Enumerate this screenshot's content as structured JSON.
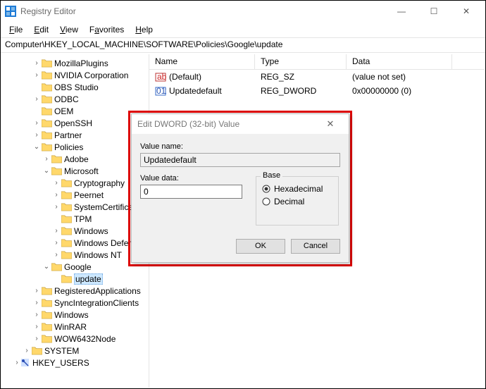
{
  "window": {
    "title": "Registry Editor"
  },
  "menu": {
    "file": "File",
    "edit": "Edit",
    "view": "View",
    "favorites": "Favorites",
    "help": "Help"
  },
  "address": "Computer\\HKEY_LOCAL_MACHINE\\SOFTWARE\\Policies\\Google\\update",
  "tree": {
    "items": [
      {
        "indent": 3,
        "twisty": ">",
        "label": "MozillaPlugins"
      },
      {
        "indent": 3,
        "twisty": ">",
        "label": "NVIDIA Corporation"
      },
      {
        "indent": 3,
        "twisty": "",
        "label": "OBS Studio"
      },
      {
        "indent": 3,
        "twisty": ">",
        "label": "ODBC"
      },
      {
        "indent": 3,
        "twisty": "",
        "label": "OEM"
      },
      {
        "indent": 3,
        "twisty": ">",
        "label": "OpenSSH"
      },
      {
        "indent": 3,
        "twisty": ">",
        "label": "Partner"
      },
      {
        "indent": 3,
        "twisty": "v",
        "label": "Policies"
      },
      {
        "indent": 4,
        "twisty": ">",
        "label": "Adobe"
      },
      {
        "indent": 4,
        "twisty": "v",
        "label": "Microsoft"
      },
      {
        "indent": 5,
        "twisty": ">",
        "label": "Cryptography"
      },
      {
        "indent": 5,
        "twisty": ">",
        "label": "Peernet"
      },
      {
        "indent": 5,
        "twisty": ">",
        "label": "SystemCertificates"
      },
      {
        "indent": 5,
        "twisty": "",
        "label": "TPM"
      },
      {
        "indent": 5,
        "twisty": ">",
        "label": "Windows"
      },
      {
        "indent": 5,
        "twisty": ">",
        "label": "Windows Defender"
      },
      {
        "indent": 5,
        "twisty": ">",
        "label": "Windows NT"
      },
      {
        "indent": 4,
        "twisty": "v",
        "label": "Google"
      },
      {
        "indent": 5,
        "twisty": "",
        "label": "update",
        "selected": true
      },
      {
        "indent": 3,
        "twisty": ">",
        "label": "RegisteredApplications"
      },
      {
        "indent": 3,
        "twisty": ">",
        "label": "SyncIntegrationClients"
      },
      {
        "indent": 3,
        "twisty": ">",
        "label": "Windows"
      },
      {
        "indent": 3,
        "twisty": ">",
        "label": "WinRAR"
      },
      {
        "indent": 3,
        "twisty": ">",
        "label": "WOW6432Node"
      },
      {
        "indent": 2,
        "twisty": ">",
        "label": "SYSTEM"
      },
      {
        "indent": 1,
        "twisty": ">",
        "label": "HKEY_USERS"
      }
    ]
  },
  "list": {
    "cols": {
      "name": "Name",
      "type": "Type",
      "data": "Data"
    },
    "rows": [
      {
        "icon": "string",
        "name": "(Default)",
        "type": "REG_SZ",
        "data": "(value not set)"
      },
      {
        "icon": "binary",
        "name": "Updatedefault",
        "type": "REG_DWORD",
        "data": "0x00000000 (0)"
      }
    ]
  },
  "dialog": {
    "title": "Edit DWORD (32-bit) Value",
    "valueNameLabel": "Value name:",
    "valueName": "Updatedefault",
    "valueDataLabel": "Value data:",
    "valueData": "0",
    "baseLabel": "Base",
    "hex": "Hexadecimal",
    "dec": "Decimal",
    "ok": "OK",
    "cancel": "Cancel"
  }
}
